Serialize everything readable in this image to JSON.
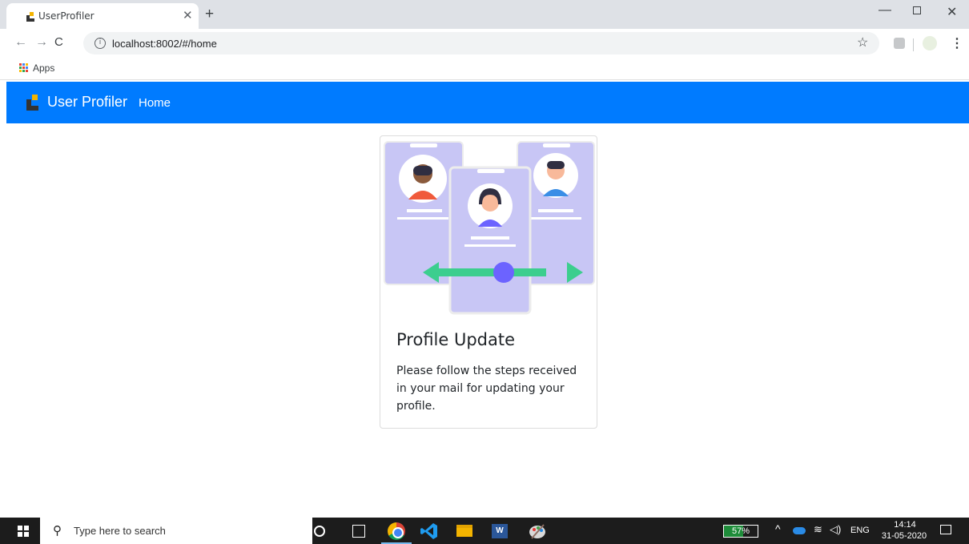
{
  "browser": {
    "tab_title": "UserProfiler",
    "tab_close": "✕",
    "new_tab": "+",
    "url": "localhost:8002/#/home",
    "bookmarks": {
      "apps_label": "Apps"
    }
  },
  "navbar": {
    "brand": "User Profiler",
    "home_link": "Home",
    "color": "#007bff"
  },
  "card": {
    "title": "Profile Update",
    "text": "Please follow the steps received in your mail for updating your profile."
  },
  "taskbar": {
    "search_placeholder": "Type here to search",
    "battery_label": "57%",
    "battery_level": 0.57,
    "language": "ENG",
    "time": "14:14",
    "date": "31-05-2020"
  },
  "colors": {
    "accent": "#007bff",
    "illustration_phone": "#c8c6f5",
    "illustration_arrow": "#3cce8e",
    "illustration_dot": "#6c63ff"
  }
}
